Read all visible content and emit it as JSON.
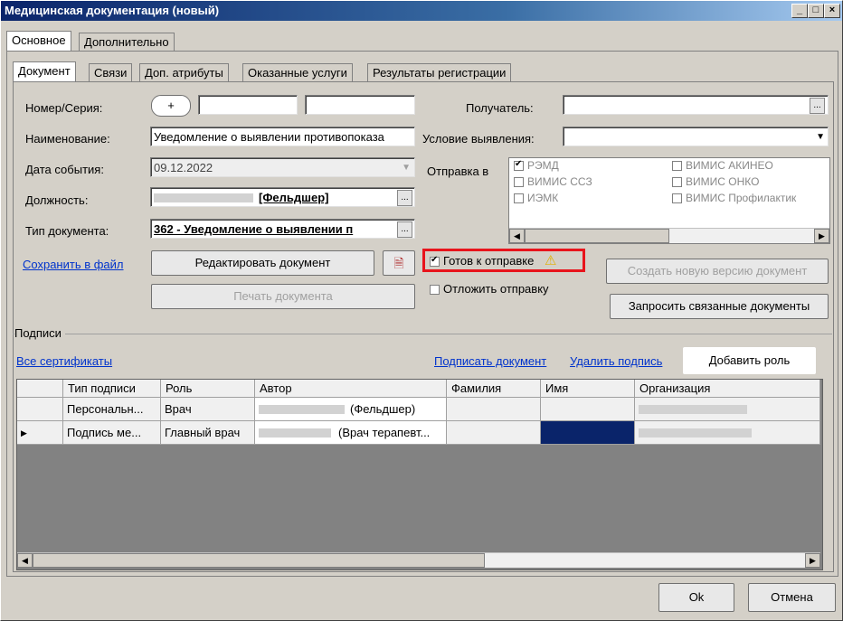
{
  "window": {
    "title": "Медицинская документация (новый)"
  },
  "top_tabs": [
    {
      "label": "Основное"
    },
    {
      "label": "Дополнительно"
    }
  ],
  "sub_tabs": [
    {
      "label": "Документ"
    },
    {
      "label": "Связи"
    },
    {
      "label": "Доп. атрибуты"
    },
    {
      "label": "Оказанные услуги"
    },
    {
      "label": "Результаты регистрации"
    }
  ],
  "form": {
    "number_label": "Номер/Серия:",
    "number_add": "+",
    "name_label": "Наименование:",
    "name_value": "Уведомление о выявлении противопоказа",
    "date_label": "Дата события:",
    "date_value": "09.12.2022",
    "position_label": "Должность:",
    "position_value": "[Фельдшер]",
    "doctype_label": "Тип документа:",
    "doctype_value": "362 - Уведомление о выявлении п",
    "browse": "...",
    "recipient_label": "Получатель:",
    "condition_label": "Условие выявления:",
    "send_label": "Отправка в"
  },
  "send_targets": [
    {
      "label": "РЭМД",
      "checked": true
    },
    {
      "label": "ВИМИС АКИНЕО",
      "checked": false
    },
    {
      "label": "ВИМИС ССЗ",
      "checked": false
    },
    {
      "label": "ВИМИС ОНКО",
      "checked": false
    },
    {
      "label": "ИЭМК",
      "checked": false
    },
    {
      "label": "ВИМИС Профилактик",
      "checked": false
    }
  ],
  "actions": {
    "save_to_file": "Сохранить в файл",
    "edit_document": "Редактировать документ",
    "print_document": "Печать документа",
    "ready_to_send": "Готов к отправке",
    "postpone_send": "Отложить отправку",
    "create_version": "Создать новую версию документ",
    "request_related": "Запросить связанные документы"
  },
  "signatures": {
    "group_label": "Подписи",
    "all_certificates": "Все сертификаты",
    "sign_document": "Подписать документ",
    "delete_signature": "Удалить подпись",
    "add_role": "Добавить роль",
    "columns": [
      "Тип подписи",
      "Роль",
      "Автор",
      "Фамилия",
      "Имя",
      "Организация"
    ],
    "rows": [
      {
        "type": "Персональн...",
        "role": "Врач",
        "author": "(Фельдшер)"
      },
      {
        "type": "Подпись ме...",
        "role": "Главный врач",
        "author": "(Врач терапевт..."
      }
    ]
  },
  "footer": {
    "ok": "Ok",
    "cancel": "Отмена"
  },
  "colors": {
    "title_bar": "#0a246a",
    "highlight": "#e8141c",
    "selection": "#0a246a",
    "link": "#0033cc"
  }
}
